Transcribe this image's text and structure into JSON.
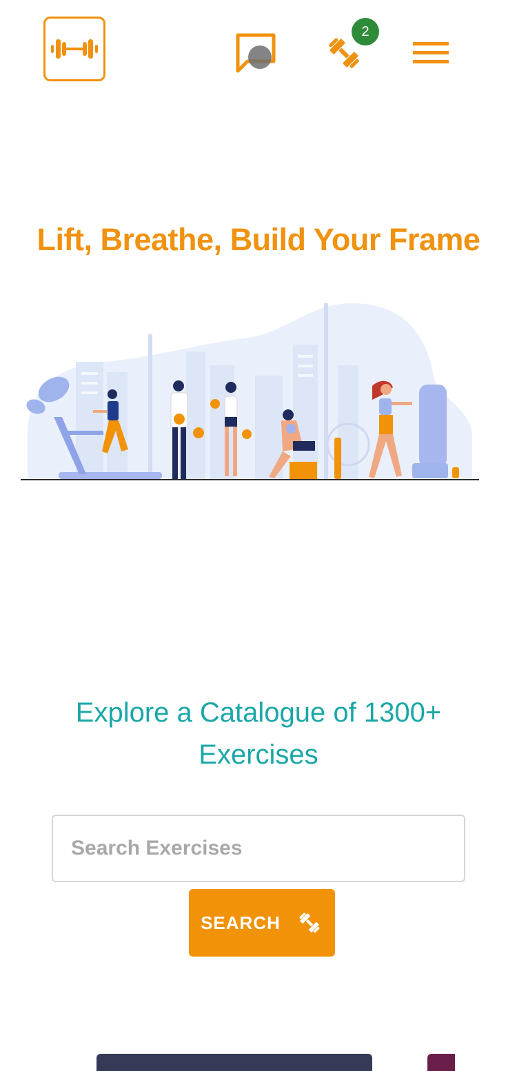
{
  "header": {
    "logo_icon": "dumbbell-icon",
    "chat_icon": "chat-icon",
    "workout_icon": "dumbbell-diagonal-icon",
    "workout_badge_count": "2",
    "menu_icon": "hamburger-menu-icon"
  },
  "hero": {
    "title": "Lift, Breathe, Build Your Frame"
  },
  "explore": {
    "title": "Explore a Catalogue of 1300+ Exercises",
    "search_placeholder": "Search Exercises",
    "search_button_label": "SEARCH",
    "search_button_icon": "dumbbell-diagonal-icon"
  },
  "colors": {
    "brand_orange": "#f0920f",
    "teal": "#1aa7a8",
    "badge_green": "#2e8b3a",
    "card_dark": "#363a56",
    "card_maroon": "#6a1f4a"
  }
}
